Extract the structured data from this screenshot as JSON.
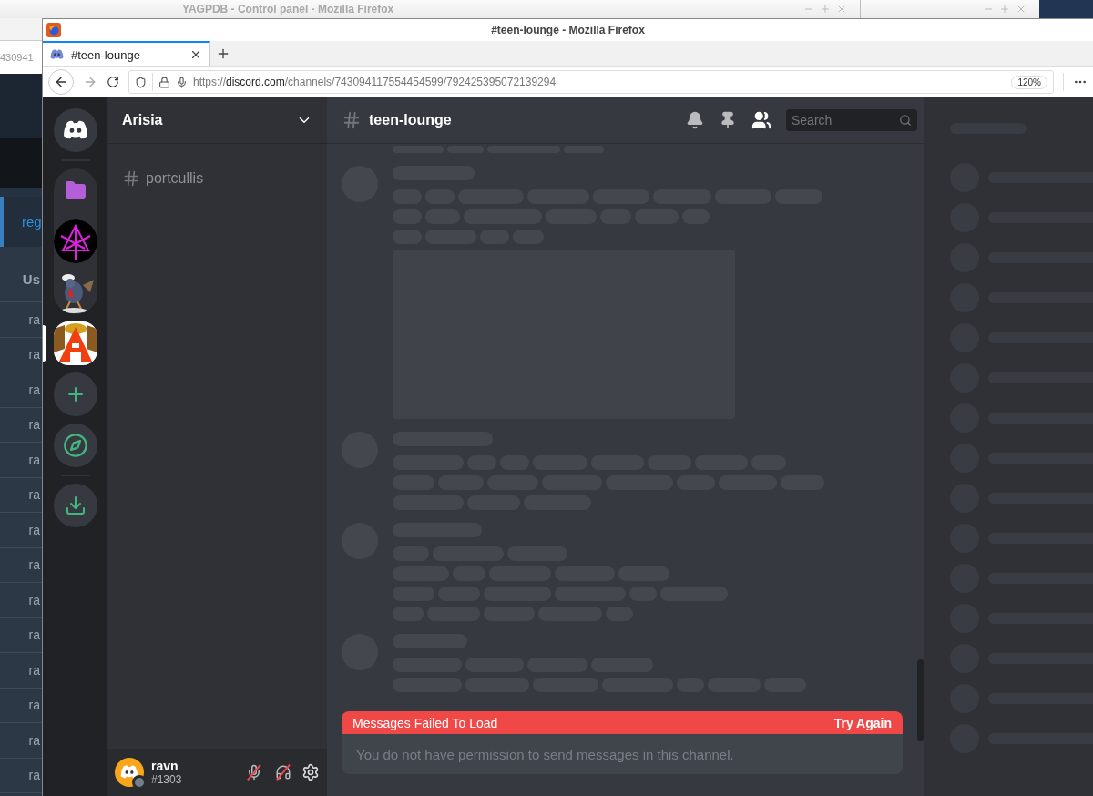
{
  "background_window": {
    "title": "YAGPDB - Control panel - Mozilla Firefox",
    "url_fragment": "430941",
    "tab_fragment": "reg",
    "column_fragment": "Us",
    "row_fragments": [
      "ra",
      "ra",
      "ra",
      "ra",
      "ra",
      "ra",
      "ra",
      "ra",
      "ra",
      "ra",
      "ra",
      "ra",
      "ra",
      "ra"
    ]
  },
  "browser": {
    "title": "#teen-lounge - Mozilla Firefox",
    "tabs": [
      {
        "label": "#teen-lounge",
        "selected": true
      }
    ],
    "url": {
      "scheme": "https://",
      "domain": "discord.com",
      "path": "/channels/743094117554454599/792425395072139294"
    },
    "zoom": "120%"
  },
  "servers": [
    {
      "kind": "home",
      "selected": false
    },
    {
      "kind": "folder",
      "expanded": true,
      "servers": [
        {
          "selected": false
        },
        {
          "selected": false
        }
      ]
    },
    {
      "kind": "server",
      "selected": true
    },
    {
      "kind": "add",
      "selected": false
    },
    {
      "kind": "explore",
      "selected": false
    },
    {
      "kind": "download",
      "selected": false
    }
  ],
  "sidebar": {
    "server_name": "Arisia",
    "channels": [
      {
        "name": "portcullis",
        "selected": false
      }
    ]
  },
  "chat": {
    "channel": "teen-lounge",
    "member_list": {
      "on": true
    },
    "search": {
      "placeholder": "Search"
    },
    "error": {
      "text": "Messages Failed To Load",
      "action": "Try Again"
    },
    "composer": {
      "placeholder": "You do not have permission to send messages in this channel."
    }
  },
  "user": {
    "name": "ravn",
    "tag": "#1303",
    "muted": true,
    "deafened": true
  }
}
